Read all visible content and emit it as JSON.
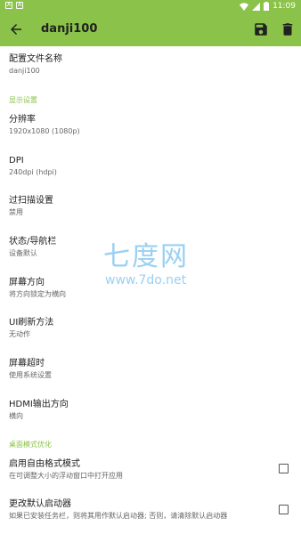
{
  "status_bar": {
    "time": "11:09",
    "notification_icons": [
      "a-box-icon",
      "a-box-icon"
    ]
  },
  "toolbar": {
    "title": "danji100"
  },
  "items": [
    {
      "title": "配置文件名称",
      "summary": "danji100"
    },
    {
      "title": "分辨率",
      "summary": "1920x1080 (1080p)"
    },
    {
      "title": "DPI",
      "summary": "240dpi (hdpi)"
    },
    {
      "title": "过扫描设置",
      "summary": "禁用"
    },
    {
      "title": "状态/导航栏",
      "summary": "设备默认"
    },
    {
      "title": "屏幕方向",
      "summary": "将方向锁定为横向"
    },
    {
      "title": "UI刷新方法",
      "summary": "无动作"
    },
    {
      "title": "屏幕超时",
      "summary": "使用系统设置"
    },
    {
      "title": "HDMI输出方向",
      "summary": "横向"
    },
    {
      "title": "启用自由格式模式",
      "summary": "在可调整大小的浮动窗口中打开应用",
      "checked": false
    },
    {
      "title": "更改默认启动器",
      "summary": "如果已安装任务栏，则将其用作默认启动器; 否则，请清除默认启动器",
      "checked": false
    }
  ],
  "categories": {
    "display": "显示设置",
    "desktop": "桌面模式优化"
  },
  "watermark": {
    "logo": "七度网",
    "url": "www.7do.net"
  },
  "colors": {
    "accent": "#8bc34a",
    "watermark": "#9ad0f3"
  }
}
